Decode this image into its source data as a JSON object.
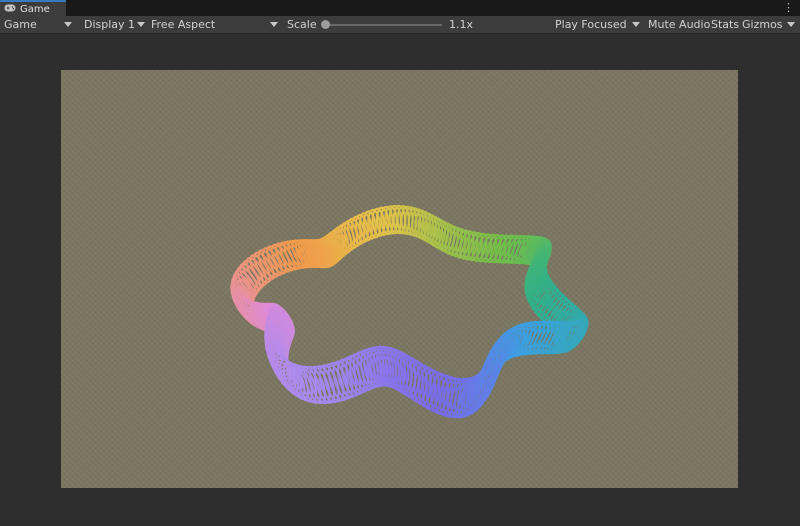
{
  "window": {
    "tab_label": "Game",
    "tab_icon": "gamepad-icon",
    "menu_icon": "kebab-menu-icon"
  },
  "toolbar": {
    "view_mode": "Game",
    "display": "Display 1",
    "aspect": "Free Aspect",
    "scale_label": "Scale",
    "scale_value": "1.1x",
    "play_mode": "Play Focused",
    "mute_audio": "Mute Audio",
    "stats": "Stats",
    "gizmos": "Gizmos"
  },
  "scene": {
    "background_color": "#7c7762",
    "object": "rainbow-coil-torus",
    "palette": [
      "#e08ad6",
      "#f29a4a",
      "#e3c24a",
      "#6fbf4a",
      "#2fb08a",
      "#3aa0e0",
      "#7a6ae8",
      "#a58af0"
    ]
  }
}
